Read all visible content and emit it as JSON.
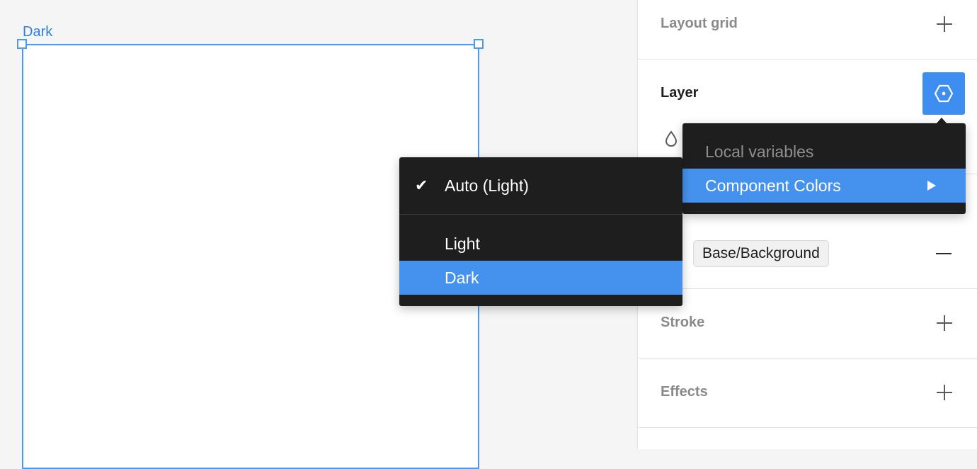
{
  "canvas": {
    "frame_label": "Dark",
    "selection_color": "#4a9bf0"
  },
  "panel": {
    "layout_grid": {
      "title": "Layout grid",
      "add_icon": "plus-icon"
    },
    "layer": {
      "title": "Layer",
      "mode_icon": "variable-mode-icon",
      "opacity_icon": "drop-icon"
    },
    "fill": {
      "token": "Base/Background",
      "remove_icon": "minus-icon"
    },
    "stroke": {
      "title": "Stroke",
      "add_icon": "plus-icon"
    },
    "effects": {
      "title": "Effects",
      "add_icon": "plus-icon"
    }
  },
  "collections_menu": {
    "items": [
      {
        "label": "Local variables",
        "state": "disabled"
      },
      {
        "label": "Component Colors",
        "state": "selected",
        "has_submenu": true
      }
    ]
  },
  "modes_menu": {
    "items": [
      {
        "label": "Auto (Light)",
        "checked": true
      },
      {
        "label": "Light"
      },
      {
        "label": "Dark",
        "state": "selected"
      }
    ]
  },
  "colors": {
    "accent": "#4592ee",
    "menu_bg": "#1e1e1e"
  }
}
